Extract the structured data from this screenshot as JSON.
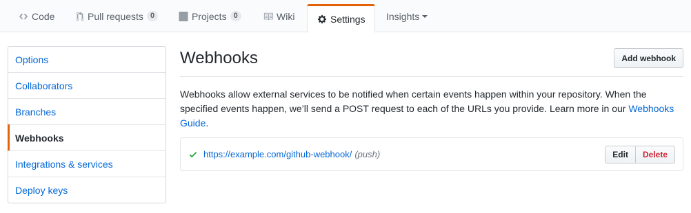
{
  "nav": {
    "tabs": [
      {
        "label": "Code",
        "icon": "code-icon"
      },
      {
        "label": "Pull requests",
        "icon": "pull-request-icon",
        "count": "0"
      },
      {
        "label": "Projects",
        "icon": "project-icon",
        "count": "0"
      },
      {
        "label": "Wiki",
        "icon": "book-icon"
      },
      {
        "label": "Settings",
        "icon": "gear-icon",
        "selected": true
      },
      {
        "label": "Insights",
        "dropdown": true
      }
    ]
  },
  "sidebar": {
    "items": [
      {
        "label": "Options"
      },
      {
        "label": "Collaborators"
      },
      {
        "label": "Branches"
      },
      {
        "label": "Webhooks",
        "selected": true
      },
      {
        "label": "Integrations & services"
      },
      {
        "label": "Deploy keys"
      }
    ]
  },
  "main": {
    "title": "Webhooks",
    "add_button": "Add webhook",
    "description": "Webhooks allow external services to be notified when certain events happen within your repository. When the specified events happen, we’ll send a POST request to each of the URLs you provide. Learn more in our ",
    "guide_link": "Webhooks Guide",
    "description_end": ".",
    "hooks": [
      {
        "status_icon": "check-icon",
        "url": "https://example.com/github-webhook/",
        "events": "(push)",
        "edit_label": "Edit",
        "delete_label": "Delete"
      }
    ]
  },
  "colors": {
    "accent": "#e36209",
    "link": "#0366d6",
    "success": "#28a745",
    "danger": "#cb2431"
  }
}
